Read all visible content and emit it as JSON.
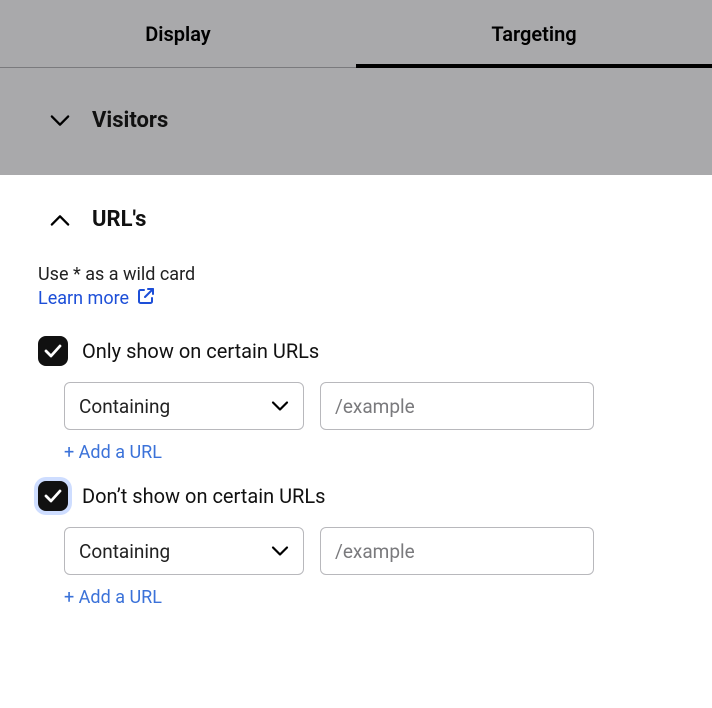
{
  "tabs": {
    "display": "Display",
    "targeting": "Targeting"
  },
  "sections": {
    "visitors": "Visitors",
    "urls": "URL's"
  },
  "urls_panel": {
    "hint": "Use * as a wild card",
    "learn_more": "Learn more",
    "only_show": {
      "label": "Only show on certain URLs",
      "operator": "Containing",
      "placeholder": "/example",
      "value": "",
      "add": "+ Add a URL"
    },
    "dont_show": {
      "label": "Don’t show on certain URLs",
      "operator": "Containing",
      "placeholder": "/example",
      "value": "",
      "add": "+ Add a URL"
    }
  }
}
